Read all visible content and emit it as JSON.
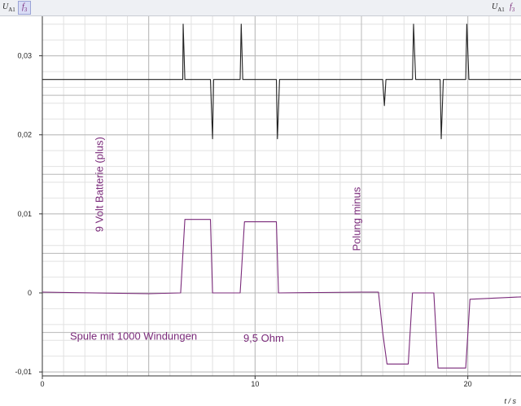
{
  "toolbar": {
    "left_channel": "U",
    "left_channel_sub": "A1",
    "left_function": "f",
    "left_function_sub": "3",
    "right_channel": "U",
    "right_channel_sub": "A1",
    "right_function": "f",
    "right_function_sub": "3"
  },
  "chart_data": {
    "type": "line",
    "xlabel": "t / s",
    "ylabel": "",
    "xlim": [
      0,
      22.5
    ],
    "ylim": [
      -0.0105,
      0.035
    ],
    "x_ticks": [
      0,
      10,
      20
    ],
    "x_tick_labels": [
      "0",
      "10",
      "20"
    ],
    "y_ticks": [
      -0.01,
      0,
      0.01,
      0.02,
      0.03
    ],
    "y_tick_labels": [
      "-0,01",
      "0",
      "0,01",
      "0,02",
      "0,03"
    ],
    "grid": true,
    "series": [
      {
        "color": "#222222",
        "x": [
          0,
          6.6,
          6.62,
          6.7,
          6.8,
          7.9,
          8.0,
          8.05,
          8.15,
          9.3,
          9.35,
          9.42,
          9.55,
          11.0,
          11.05,
          11.15,
          16.0,
          16.08,
          16.15,
          16.25,
          17.4,
          17.45,
          17.55,
          18.7,
          18.75,
          18.85,
          19.9,
          19.95,
          20.05,
          22.5
        ],
        "y": [
          0.027,
          0.027,
          0.034,
          0.027,
          0.027,
          0.027,
          0.0195,
          0.027,
          0.027,
          0.027,
          0.034,
          0.027,
          0.027,
          0.027,
          0.0195,
          0.027,
          0.027,
          0.0237,
          0.027,
          0.027,
          0.027,
          0.034,
          0.027,
          0.027,
          0.0195,
          0.027,
          0.027,
          0.034,
          0.027,
          0.027
        ]
      },
      {
        "color": "#7a2a7a",
        "x": [
          0,
          5.0,
          6.5,
          6.7,
          7.9,
          8.0,
          9.3,
          9.5,
          11.0,
          11.1,
          15.0,
          15.8,
          16.0,
          16.2,
          17.2,
          17.4,
          18.4,
          18.6,
          19.9,
          20.1,
          22.5
        ],
        "y": [
          0.0001,
          -0.0001,
          0.0,
          0.0093,
          0.0093,
          0.0,
          0.0,
          0.009,
          0.009,
          0.0,
          0.0001,
          0.0001,
          -0.005,
          -0.009,
          -0.009,
          0.0,
          0.0,
          -0.0095,
          -0.0095,
          -0.0008,
          -0.0005
        ]
      }
    ],
    "annotations": [
      {
        "text": "9 Volt Batterie (plus)",
        "x": 2.85,
        "y": 0.0077,
        "rotation": -90
      },
      {
        "text": "Polung minus",
        "x": 14.95,
        "y": 0.0053,
        "rotation": -90
      },
      {
        "text": "Spule mit 1000 Windungen",
        "x": 1.3,
        "y": -0.0059,
        "rotation": 0
      },
      {
        "text": "9,5 Ohm",
        "x": 9.45,
        "y": -0.0062,
        "rotation": 0
      }
    ]
  }
}
